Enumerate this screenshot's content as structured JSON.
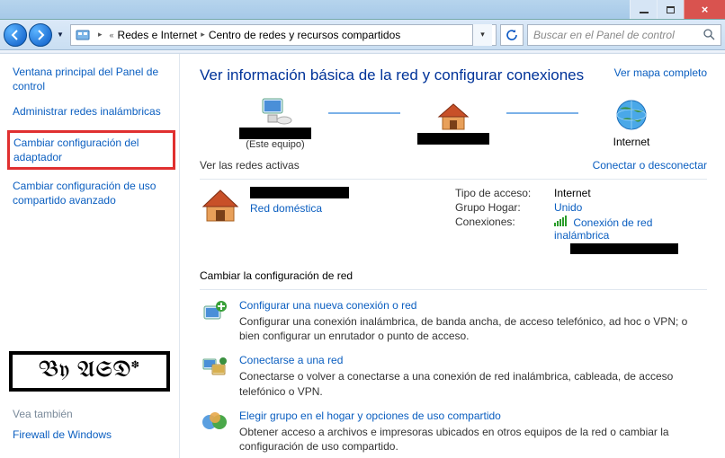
{
  "breadcrumb": {
    "level1": "Redes e Internet",
    "level2": "Centro de redes y recursos compartidos"
  },
  "search": {
    "placeholder": "Buscar en el Panel de control"
  },
  "sidebar": {
    "items": [
      {
        "label": "Ventana principal del Panel de control"
      },
      {
        "label": "Administrar redes inalámbricas"
      },
      {
        "label": "Cambiar configuración del adaptador"
      },
      {
        "label": "Cambiar configuración de uso compartido avanzado"
      }
    ],
    "badge": "By ASD*",
    "see_also": "Vea también",
    "footer_links": [
      {
        "label": "Firewall de Windows"
      }
    ]
  },
  "main": {
    "title": "Ver información básica de la red y configurar conexiones",
    "map_link": "Ver mapa completo",
    "nodes": {
      "this_pc_sub": "(Este equipo)",
      "internet": "Internet"
    },
    "active_networks_head": "Ver las redes activas",
    "connect_link": "Conectar o desconectar",
    "home_network": "Red doméstica",
    "details": {
      "access_type_k": "Tipo de acceso:",
      "access_type_v": "Internet",
      "homegroup_k": "Grupo Hogar:",
      "homegroup_v": "Unido",
      "connections_k": "Conexiones:",
      "connections_v": "Conexión de red inalámbrica"
    },
    "config_head": "Cambiar la configuración de red",
    "tasks": [
      {
        "title": "Configurar una nueva conexión o red",
        "desc": "Configurar una conexión inalámbrica, de banda ancha, de acceso telefónico, ad hoc o VPN; o bien configurar un enrutador o punto de acceso."
      },
      {
        "title": "Conectarse a una red",
        "desc": "Conectarse o volver a conectarse a una conexión de red inalámbrica, cableada, de acceso telefónico o VPN."
      },
      {
        "title": "Elegir grupo en el hogar y opciones de uso compartido",
        "desc": "Obtener acceso a archivos e impresoras ubicados en otros equipos de la red o cambiar la configuración de uso compartido."
      }
    ]
  }
}
